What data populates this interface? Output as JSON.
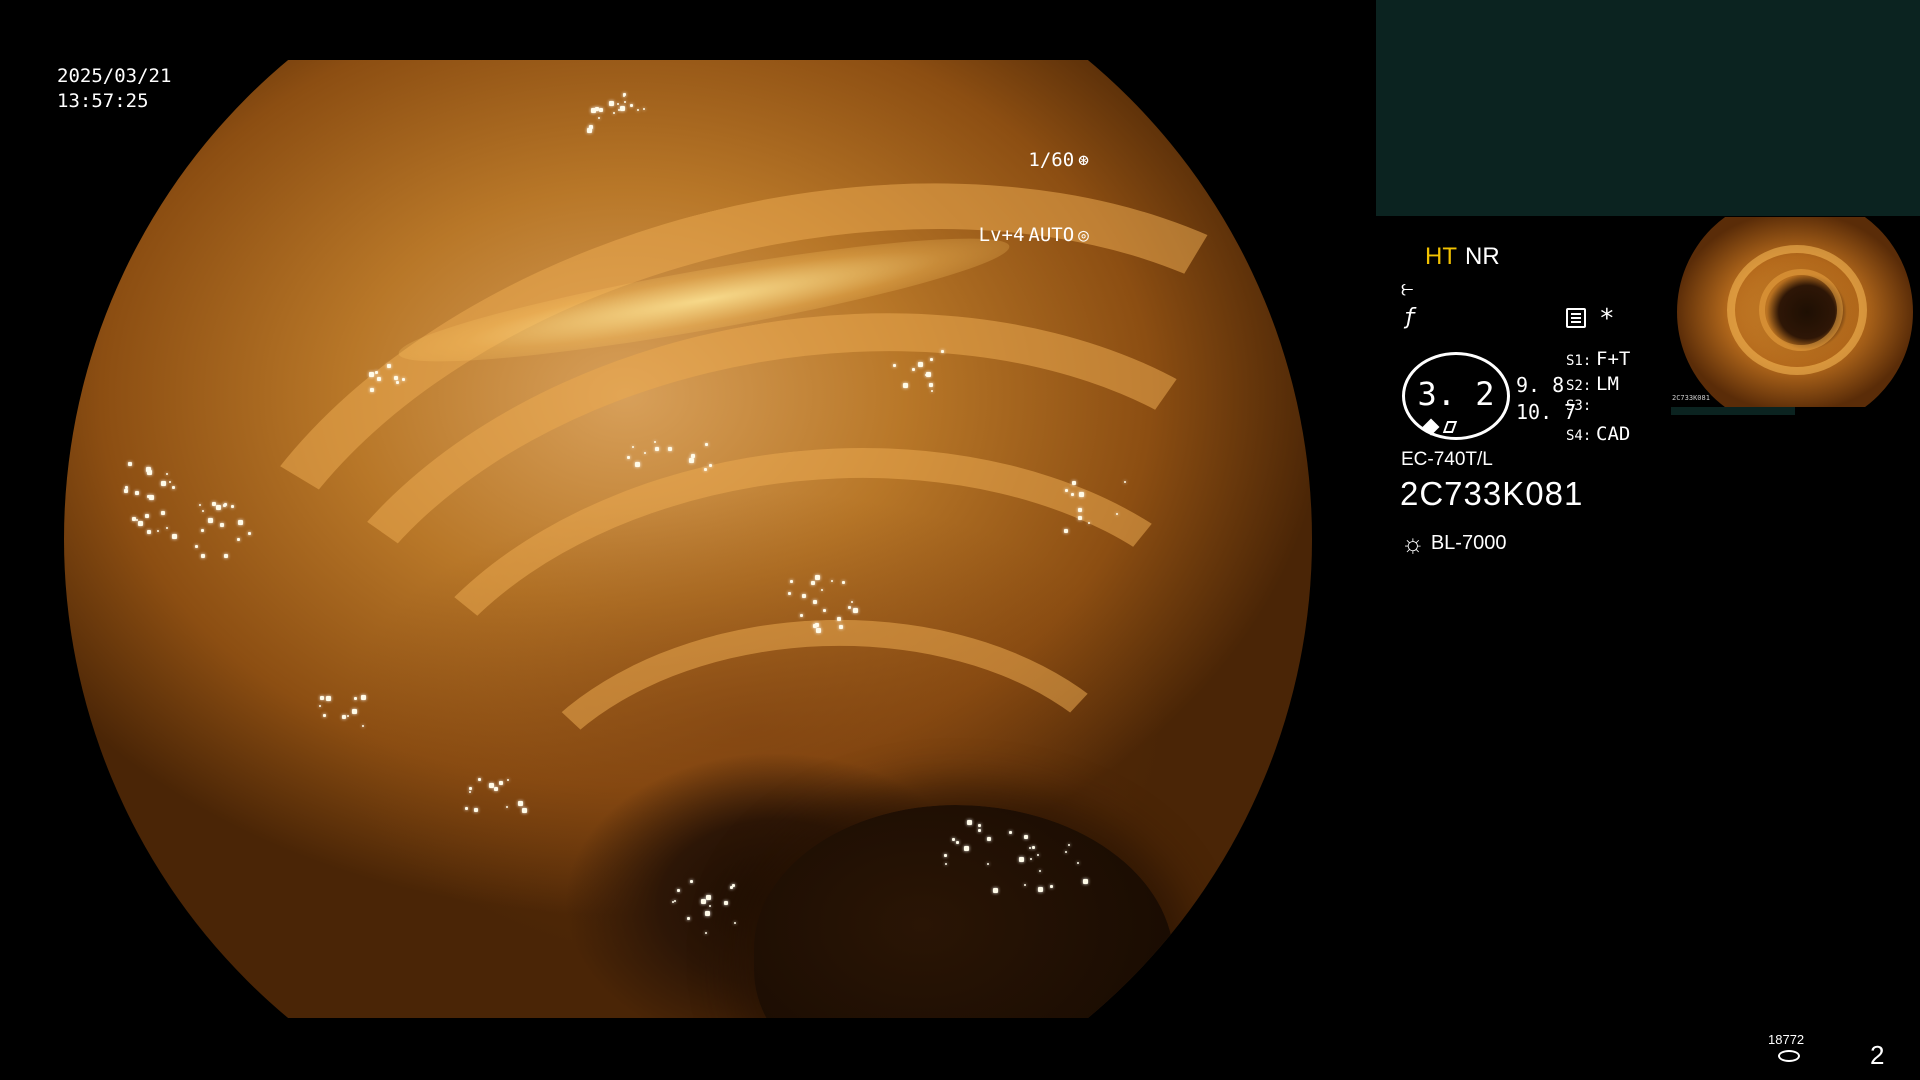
{
  "overlay": {
    "date": "2025/03/21",
    "time": "13:57:25",
    "shutter": "1/60",
    "shutter_icon": "aperture-icon",
    "level": "Lv+4",
    "exposure_mode": "AUTO",
    "exposure_icon": "target-icon"
  },
  "panel": {
    "mode_ht": "HT",
    "mode_nr": "NR",
    "mode_ht_color": "#f2c200",
    "header_color": "#0b2320",
    "asterisk": "*",
    "zoom": {
      "value": "3. 2",
      "upper": "9. 8",
      "lower": "10. 7"
    },
    "switches": [
      {
        "key": "S1:",
        "value": "F+T"
      },
      {
        "key": "S2:",
        "value": "LM"
      },
      {
        "key": "S3:",
        "value": ""
      },
      {
        "key": "S4:",
        "value": "CAD"
      }
    ],
    "scope_model": "EC-740T/L",
    "scope_serial": "2C733K081",
    "light_source": "BL-7000",
    "light_icon": "sun-icon"
  },
  "pip": {
    "serial_tag": "2C733K081"
  },
  "footer": {
    "record_count": "18772",
    "page": "2"
  }
}
